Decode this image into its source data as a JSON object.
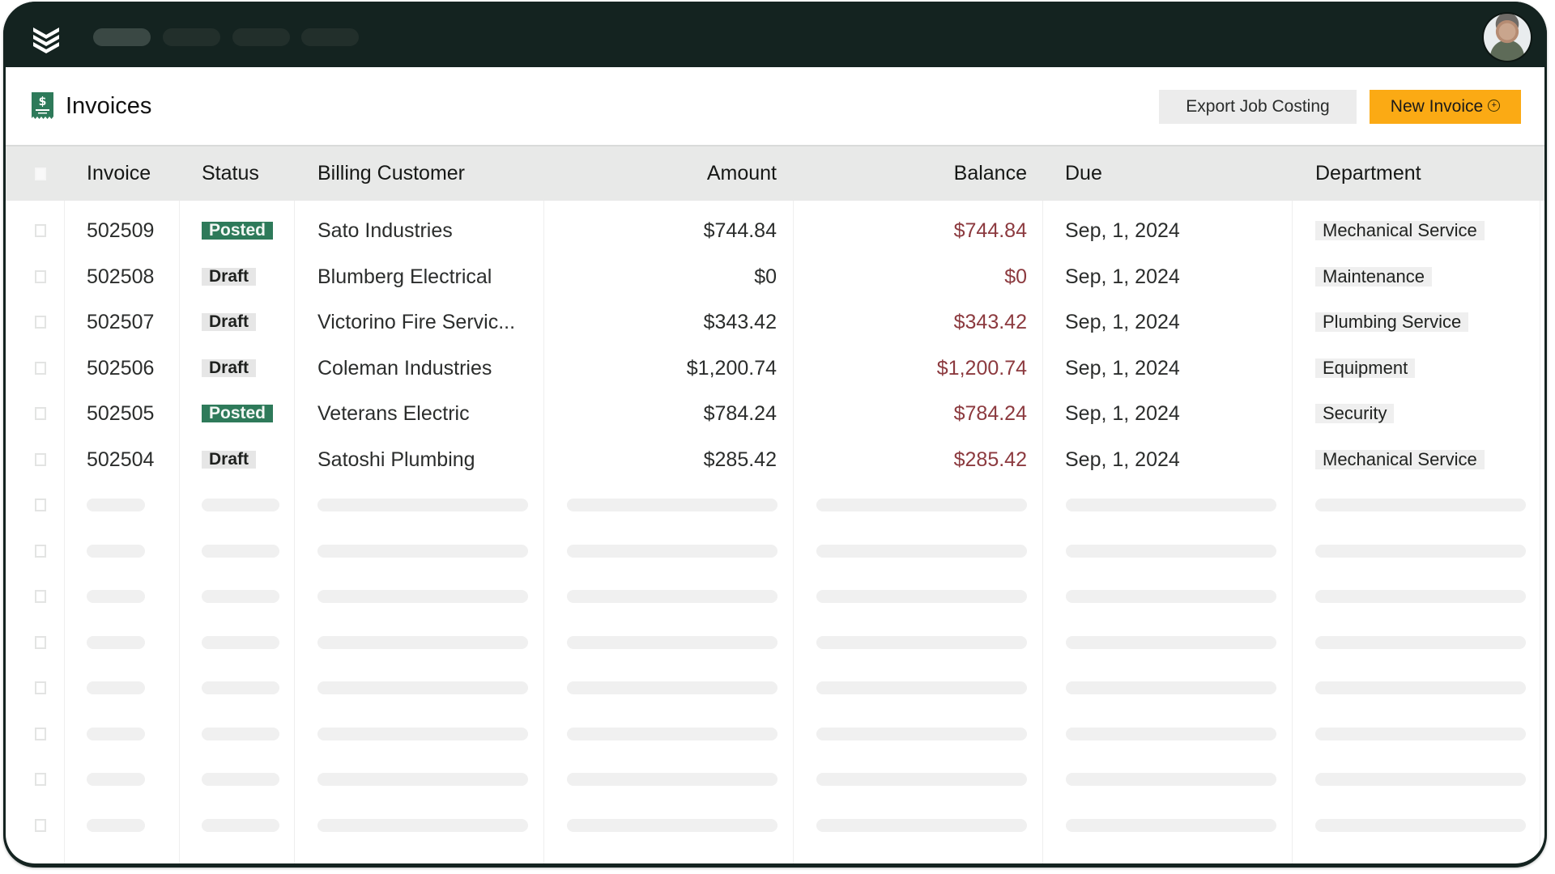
{
  "topbar": {
    "logo_icon": "chevron-stack-logo-icon",
    "nav_pills": [
      {
        "state": "active"
      },
      {
        "state": "inactive"
      },
      {
        "state": "inactive"
      },
      {
        "state": "inactive"
      }
    ],
    "avatar_icon": "user-avatar"
  },
  "page": {
    "icon": "invoice-receipt-icon",
    "title": "Invoices",
    "export_label": "Export Job Costing",
    "new_invoice_label": "New Invoice",
    "new_invoice_icon": "plus-circle-icon"
  },
  "colors": {
    "topbar": "#142320",
    "accent_button": "#fbaa14",
    "posted_badge": "#2e7a5a",
    "balance_text": "#8c3a3f"
  },
  "table": {
    "columns": [
      "Invoice",
      "Status",
      "Billing Customer",
      "Amount",
      "Balance",
      "Due",
      "Department"
    ],
    "rows": [
      {
        "invoice": "502509",
        "status": "Posted",
        "customer": "Sato Industries",
        "amount": "$744.84",
        "balance": "$744.84",
        "due": "Sep, 1, 2024",
        "department": "Mechanical Service"
      },
      {
        "invoice": "502508",
        "status": "Draft",
        "customer": "Blumberg Electrical",
        "amount": "$0",
        "balance": "$0",
        "due": "Sep, 1, 2024",
        "department": "Maintenance"
      },
      {
        "invoice": "502507",
        "status": "Draft",
        "customer": "Victorino Fire Servic...",
        "amount": "$343.42",
        "balance": "$343.42",
        "due": "Sep, 1, 2024",
        "department": "Plumbing Service"
      },
      {
        "invoice": "502506",
        "status": "Draft",
        "customer": "Coleman Industries",
        "amount": "$1,200.74",
        "balance": "$1,200.74",
        "due": "Sep, 1, 2024",
        "department": "Equipment"
      },
      {
        "invoice": "502505",
        "status": "Posted",
        "customer": "Veterans Electric",
        "amount": "$784.24",
        "balance": "$784.24",
        "due": "Sep, 1, 2024",
        "department": "Security"
      },
      {
        "invoice": "502504",
        "status": "Draft",
        "customer": "Satoshi Plumbing",
        "amount": "$285.42",
        "balance": "$285.42",
        "due": "Sep, 1, 2024",
        "department": "Mechanical Service"
      }
    ],
    "skeleton_row_count": 9
  }
}
